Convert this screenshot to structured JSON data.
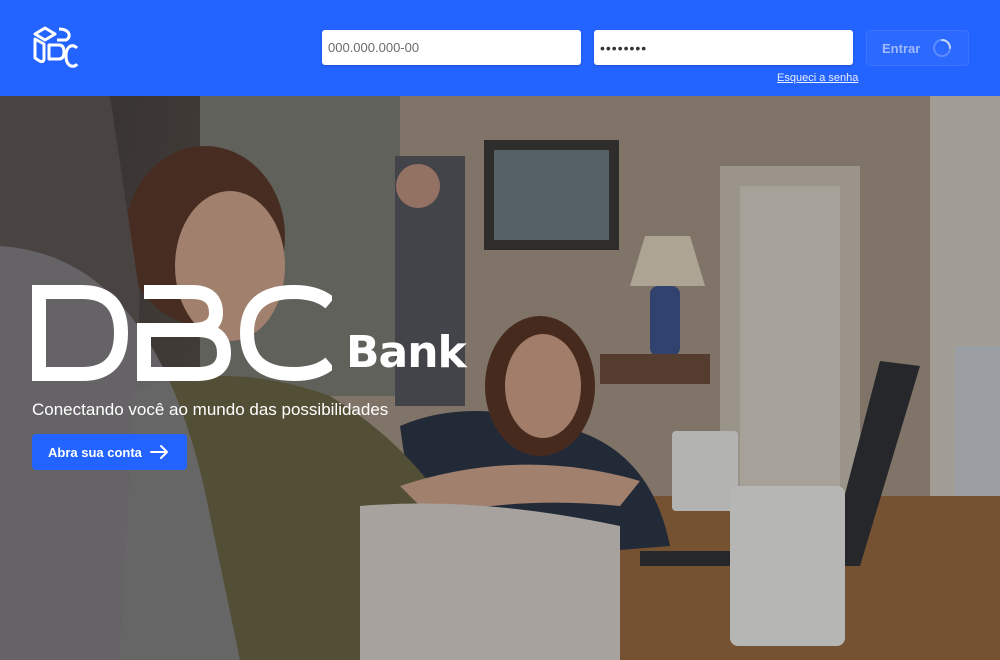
{
  "header": {
    "logo_icon": "dbc-cube-logo-icon",
    "cpf_placeholder": "000.000.000-00",
    "password_value": "••••••••",
    "forgot_password": "Esqueci a senha",
    "enter_label": "Entrar",
    "loading_icon": "spinner-icon"
  },
  "hero": {
    "brand_main": "DBC",
    "brand_sub": "Bank",
    "tagline": "Conectando você ao mundo das possibilidades",
    "cta_label": "Abra sua conta",
    "cta_icon": "arrow-right-icon"
  },
  "colors": {
    "primary": "#2363ff",
    "white": "#ffffff"
  }
}
